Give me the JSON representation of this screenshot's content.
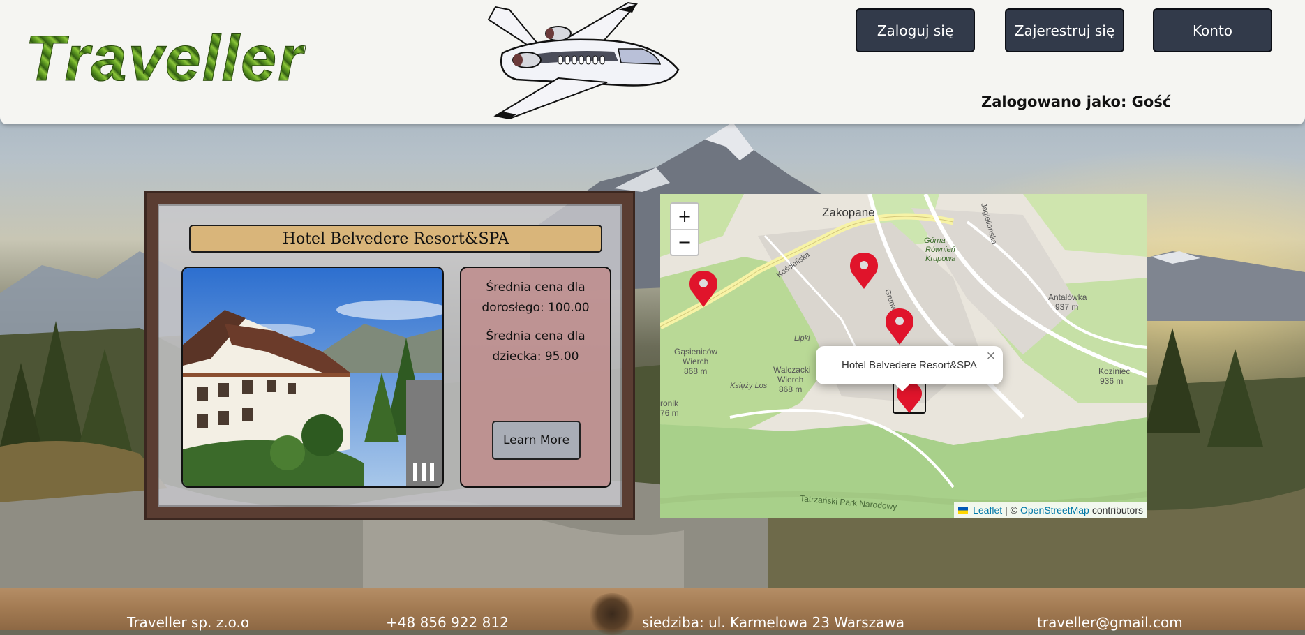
{
  "header": {
    "logo_text": "Traveller",
    "buttons": {
      "login": "Zaloguj się",
      "register": "Zajerestruj się",
      "account": "Konto"
    },
    "logged_as": "Zalogowano jako: Gość"
  },
  "hotel_card": {
    "title": "Hotel Belvedere Resort&SPA",
    "adult_price": "Średnia cena dla dorosłego: 100.00",
    "child_price": "Średnia cena dla dziecka: 95.00",
    "learn_more": "Learn More"
  },
  "map": {
    "zoom_in": "+",
    "zoom_out": "−",
    "popup_text": "Hotel Belvedere Resort&SPA",
    "popup_close": "×",
    "labels": {
      "city": "Zakopane",
      "gorna": "Górna",
      "rowien": "Równień",
      "krupowa": "Krupowa",
      "koscieliska": "Kościeliska",
      "jagiellonska": "Jagiellońska",
      "grunwaldzka": "Grunwal",
      "antalowka": "Antałówka",
      "antalowka_h": "937 m",
      "gasienicow": "Gąsieniców",
      "wierch1": "Wierch",
      "gasienicow_h": "868 m",
      "lipki": "Lipki",
      "walczacki": "Walczacki",
      "wierch2": "Wierch",
      "walczacki_h": "868 m",
      "ksiezy_los": "Księży Los",
      "kozimiec": "Koziniec",
      "kozimiec_h": "936 m",
      "ronik": "ronik",
      "ronik_h": "76 m",
      "tatra": "Tatrzański Park Narodowy"
    },
    "attribution": {
      "leaflet": "Leaflet",
      "sep": "| ©",
      "osm": "OpenStreetMap",
      "contributors": "contributors"
    }
  },
  "footer": {
    "company": "Traveller sp. z.o.o",
    "phone": "+48 856 922 812",
    "address": "siedziba: ul. Karmelowa 23 Warszawa",
    "email": "traveller@gmail.com"
  }
}
